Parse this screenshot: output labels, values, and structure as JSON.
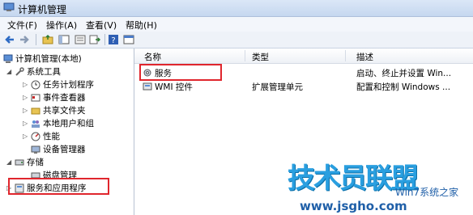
{
  "window": {
    "title": "计算机管理"
  },
  "menu": [
    "文件(F)",
    "操作(A)",
    "查看(V)",
    "帮助(H)"
  ],
  "toolbar_icons": [
    "back-icon",
    "forward-icon",
    "up-folder-icon",
    "show-hide-tree-icon",
    "properties-icon",
    "export-icon",
    "help-icon",
    "console-icon"
  ],
  "tree": {
    "root": "计算机管理(本地)",
    "system_tools": "系统工具",
    "task_scheduler": "任务计划程序",
    "event_viewer": "事件查看器",
    "shared_folders": "共享文件夹",
    "local_users": "本地用户和组",
    "performance": "性能",
    "device_manager": "设备管理器",
    "storage": "存储",
    "disk_management": "磁盘管理",
    "services_apps": "服务和应用程序"
  },
  "list": {
    "columns": [
      "名称",
      "类型",
      "描述"
    ],
    "rows": [
      {
        "name": "服务",
        "type": "",
        "description": "启动、终止并设置 Win..."
      },
      {
        "name": "WMI 控件",
        "type": "扩展管理单元",
        "description": "配置和控制 Windows ..."
      }
    ]
  },
  "watermark": {
    "main": "技术员联盟",
    "sub": "Win7系统之家",
    "url": "www.jsgho.com"
  },
  "colors": {
    "highlight": "#e0262d",
    "watermark": "#2a9fe0"
  }
}
